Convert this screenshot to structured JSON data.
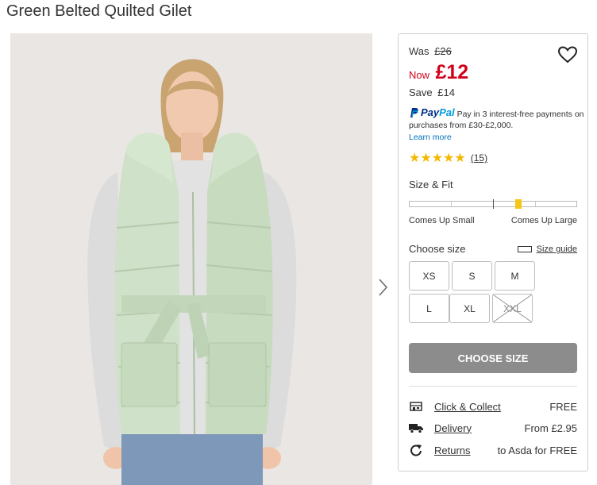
{
  "product": {
    "title": "Green Belted Quilted Gilet"
  },
  "price": {
    "was_label": "Was",
    "was_value": "£26",
    "now_label": "Now",
    "now_value": "£12",
    "save_label": "Save",
    "save_value": "£14",
    "accent_color": "#d0021b"
  },
  "paypal": {
    "logo_pay": "Pay",
    "logo_pal": "Pal",
    "text": "Pay in 3 interest-free payments on purchases from £30-£2,000.",
    "learn_more": "Learn more"
  },
  "rating": {
    "stars_text": "★★★★★",
    "stars": 5,
    "count": "(15)"
  },
  "fit": {
    "title": "Size & Fit",
    "low_label": "Comes Up Small",
    "high_label": "Comes Up Large",
    "level_fraction": 0.65
  },
  "sizes": {
    "title": "Choose size",
    "guide_label": "Size guide",
    "options": [
      {
        "label": "XS",
        "available": true
      },
      {
        "label": "S",
        "available": true
      },
      {
        "label": "M",
        "available": true
      },
      {
        "label": "L",
        "available": true
      },
      {
        "label": "XL",
        "available": true
      },
      {
        "label": "XXL",
        "available": false
      }
    ]
  },
  "cta": {
    "label": "CHOOSE SIZE"
  },
  "delivery": [
    {
      "icon": "store-icon",
      "label": "Click & Collect",
      "value": "FREE"
    },
    {
      "icon": "truck-icon",
      "label": "Delivery",
      "value": "From £2.95"
    },
    {
      "icon": "returns-icon",
      "label": "Returns",
      "value": "to Asda for FREE"
    }
  ]
}
